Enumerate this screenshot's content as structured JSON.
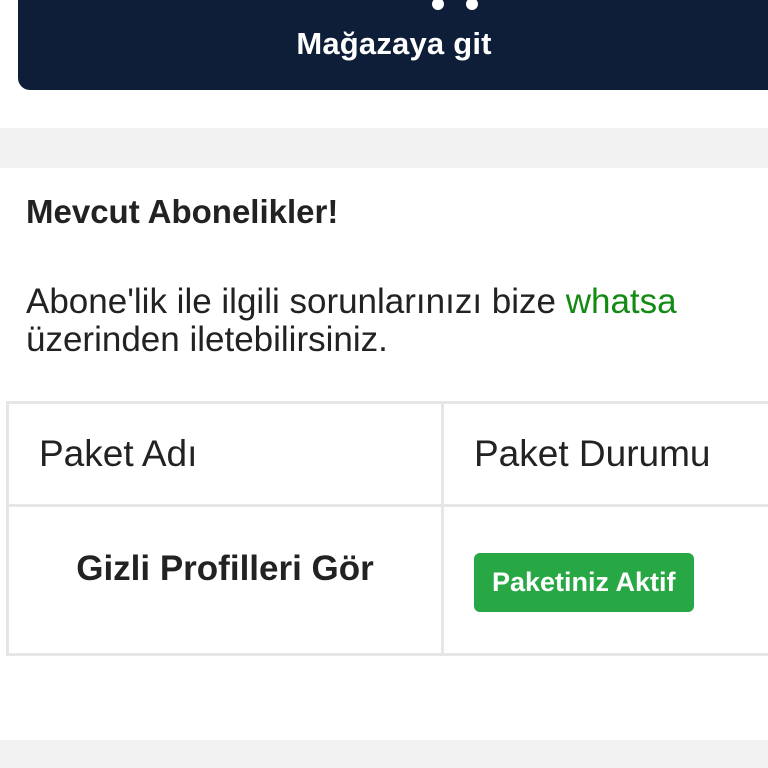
{
  "store": {
    "label": "Mağazaya git",
    "icon": "store-icon"
  },
  "subscriptions": {
    "title": "Mevcut Abonelikler!",
    "info_prefix": "Abone'lik ile ilgili sorunlarınızı bize ",
    "info_link": "whatsa",
    "info_suffix": "üzerinden iletebilirsiniz.",
    "link_color": "#138a13"
  },
  "table": {
    "headers": [
      "Paket Adı",
      "Paket Durumu"
    ],
    "rows": [
      {
        "name": "Gizli Profilleri Gör",
        "status": "Paketiniz Aktif"
      }
    ]
  },
  "colors": {
    "primary_dark": "#0e1d38",
    "success": "#28a745"
  }
}
